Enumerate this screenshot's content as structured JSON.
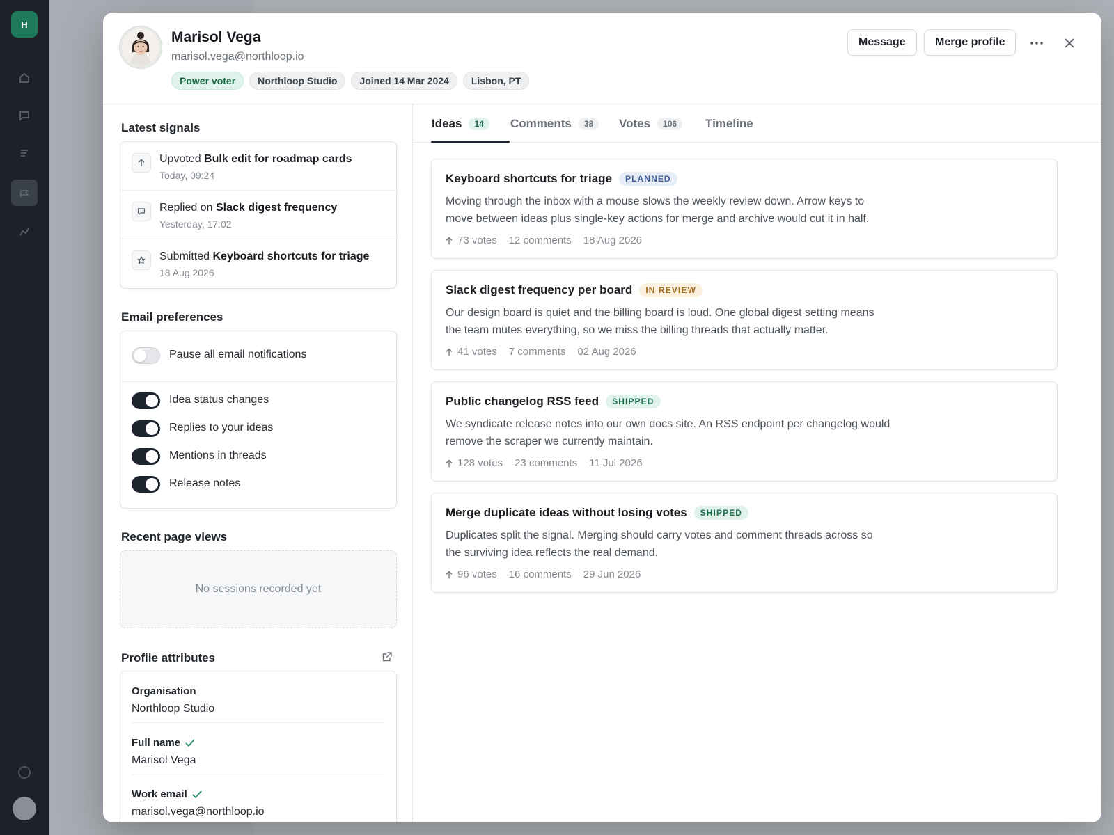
{
  "background_app": {
    "rail_logo": "H"
  },
  "profile": {
    "name": "Marisol Vega",
    "email": "marisol.vega@northloop.io",
    "chips": [
      "Power voter",
      "Northloop Studio",
      "Joined 14 Mar 2024",
      "Lisbon, PT"
    ]
  },
  "header_actions": {
    "message_label": "Message",
    "merge_label": "Merge profile",
    "more_icon": "more-horizontal-icon",
    "close_icon": "close-icon"
  },
  "signals": {
    "title": "Latest signals",
    "items": [
      {
        "icon": "arrow-up-icon",
        "action": "Upvoted",
        "target": "Bulk edit for roadmap cards",
        "time": "Today, 09:24"
      },
      {
        "icon": "comment-icon",
        "action": "Replied on",
        "target": "Slack digest frequency",
        "time": "Yesterday, 17:02"
      },
      {
        "icon": "star-icon",
        "action": "Submitted",
        "target": "Keyboard shortcuts for triage",
        "time": "18 Aug 2026"
      }
    ]
  },
  "email_prefs": {
    "title": "Email preferences",
    "pause": {
      "label": "Pause all email notifications",
      "on": false
    },
    "items": [
      {
        "label": "Idea status changes",
        "on": true
      },
      {
        "label": "Replies to your ideas",
        "on": true
      },
      {
        "label": "Mentions in threads",
        "on": true
      },
      {
        "label": "Release notes",
        "on": true
      }
    ]
  },
  "page_views": {
    "title": "Recent page views",
    "empty_text": "No sessions recorded yet"
  },
  "attributes": {
    "title": "Profile attributes",
    "items": [
      {
        "label": "Organisation",
        "value": "Northloop Studio",
        "verified": false
      },
      {
        "label": "Full name",
        "value": "Marisol Vega",
        "verified": true
      },
      {
        "label": "Work email",
        "value": "marisol.vega@northloop.io",
        "verified": true
      }
    ]
  },
  "tabs": [
    {
      "label": "Ideas",
      "count": "14",
      "active": true
    },
    {
      "label": "Comments",
      "count": "38",
      "active": false
    },
    {
      "label": "Votes",
      "count": "106",
      "active": false
    },
    {
      "label": "Timeline",
      "count": "",
      "active": false
    }
  ],
  "ideas": [
    {
      "title": "Keyboard shortcuts for triage",
      "status": "PLANNED",
      "status_kind": "planned",
      "description": "Moving through the inbox with a mouse slows the weekly review down. Arrow keys to move between ideas plus single-key actions for merge and archive would cut it in half.",
      "votes": "73 votes",
      "comments": "12 comments",
      "date": "18 Aug 2026"
    },
    {
      "title": "Slack digest frequency per board",
      "status": "IN REVIEW",
      "status_kind": "review",
      "description": "Our design board is quiet and the billing board is loud. One global digest setting means the team mutes everything, so we miss the billing threads that actually matter.",
      "votes": "41 votes",
      "comments": "7 comments",
      "date": "02 Aug 2026"
    },
    {
      "title": "Public changelog RSS feed",
      "status": "SHIPPED",
      "status_kind": "shipped",
      "description": "We syndicate release notes into our own docs site. An RSS endpoint per changelog would remove the scraper we currently maintain.",
      "votes": "128 votes",
      "comments": "23 comments",
      "date": "11 Jul 2026"
    },
    {
      "title": "Merge duplicate ideas without losing votes",
      "status": "SHIPPED",
      "status_kind": "shipped",
      "description": "Duplicates split the signal. Merging should carry votes and comment threads across so the surviving idea reflects the real demand.",
      "votes": "96 votes",
      "comments": "16 comments",
      "date": "29 Jun 2026"
    }
  ],
  "colors": {
    "accent_green": "#1d6b4d",
    "toggle_on": "#1e252e",
    "planned": "#3d5a92",
    "review": "#9a6a1e"
  }
}
